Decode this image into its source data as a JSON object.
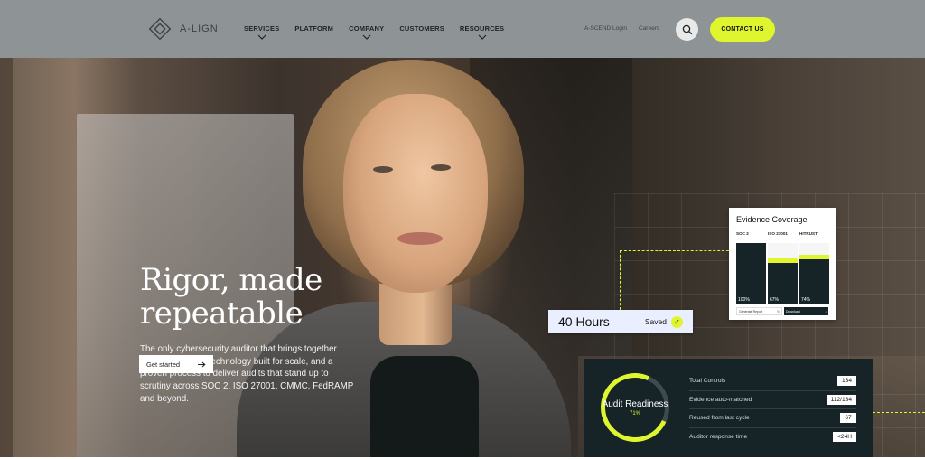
{
  "brand": {
    "name": "A-LIGN",
    "accent": "#dff52e",
    "header_bg": "#8e9495",
    "panel_dark": "#162428"
  },
  "nav": {
    "items": [
      {
        "label": "SERVICES",
        "has_dropdown": true
      },
      {
        "label": "PLATFORM",
        "has_dropdown": false
      },
      {
        "label": "COMPANY",
        "has_dropdown": true
      },
      {
        "label": "CUSTOMERS",
        "has_dropdown": false
      },
      {
        "label": "RESOURCES",
        "has_dropdown": true
      }
    ],
    "login_label": "A-SCEND Login",
    "careers_label": "Careers",
    "search_icon": "search-icon",
    "contact_label": "CONTACT US"
  },
  "hero": {
    "title_line1": "Rigor, made",
    "title_line2": "repeatable",
    "body": "The only cybersecurity auditor that brings together expert judgment, technology built for scale, and a proven process to deliver audits that stand up to scrutiny across SOC 2, ISO 27001, CMMC, FedRAMP and beyond.",
    "cta_label": "Get started",
    "cta_icon": "arrow-right-icon"
  },
  "evidence": {
    "title": "Evidence Coverage",
    "columns": [
      {
        "label": "SOC 2",
        "pct_label": "100%",
        "value": 1.0
      },
      {
        "label": "ISO 27001",
        "pct_label": "67%",
        "value": 0.67
      },
      {
        "label": "HITRUST",
        "pct_label": "74%",
        "value": 0.74
      }
    ],
    "footer_left": "Generate Report",
    "footer_right": "Download"
  },
  "hours": {
    "value": "40 Hours",
    "status": "Saved"
  },
  "audit": {
    "title": "Audit Readiness",
    "percent_label": "71%",
    "percent": 0.71,
    "stats": [
      {
        "label": "Total Controls",
        "value": "134"
      },
      {
        "label": "Evidence auto-matched",
        "value": "112/134"
      },
      {
        "label": "Reused from last cycle",
        "value": "67"
      },
      {
        "label": "Auditor response time",
        "value": "<24H"
      }
    ]
  }
}
